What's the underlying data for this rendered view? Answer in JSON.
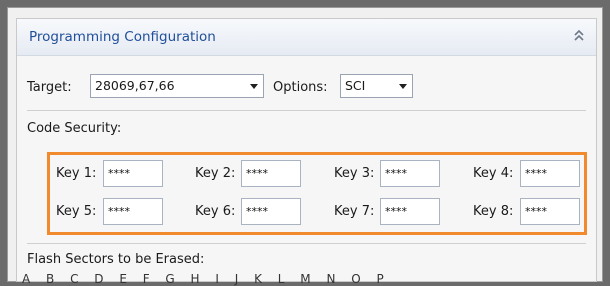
{
  "panel": {
    "title": "Programming Configuration",
    "collapse_icon": "double-chevron-up-icon"
  },
  "target": {
    "label": "Target:",
    "value": "28069,67,66"
  },
  "options": {
    "label": "Options:",
    "value": "SCI"
  },
  "code_security": {
    "label": "Code Security:",
    "accent_color": "#f08a2c",
    "keys": [
      {
        "label": "Key 1:",
        "value": "****"
      },
      {
        "label": "Key 2:",
        "value": "****"
      },
      {
        "label": "Key 3:",
        "value": "****"
      },
      {
        "label": "Key 4:",
        "value": "****"
      },
      {
        "label": "Key 5:",
        "value": "****"
      },
      {
        "label": "Key 6:",
        "value": "****"
      },
      {
        "label": "Key 7:",
        "value": "****"
      },
      {
        "label": "Key 8:",
        "value": "****"
      }
    ]
  },
  "flash": {
    "label": "Flash Sectors to be Erased:",
    "sectors_partial": "A B C D E F G H I J K L M N O P"
  }
}
